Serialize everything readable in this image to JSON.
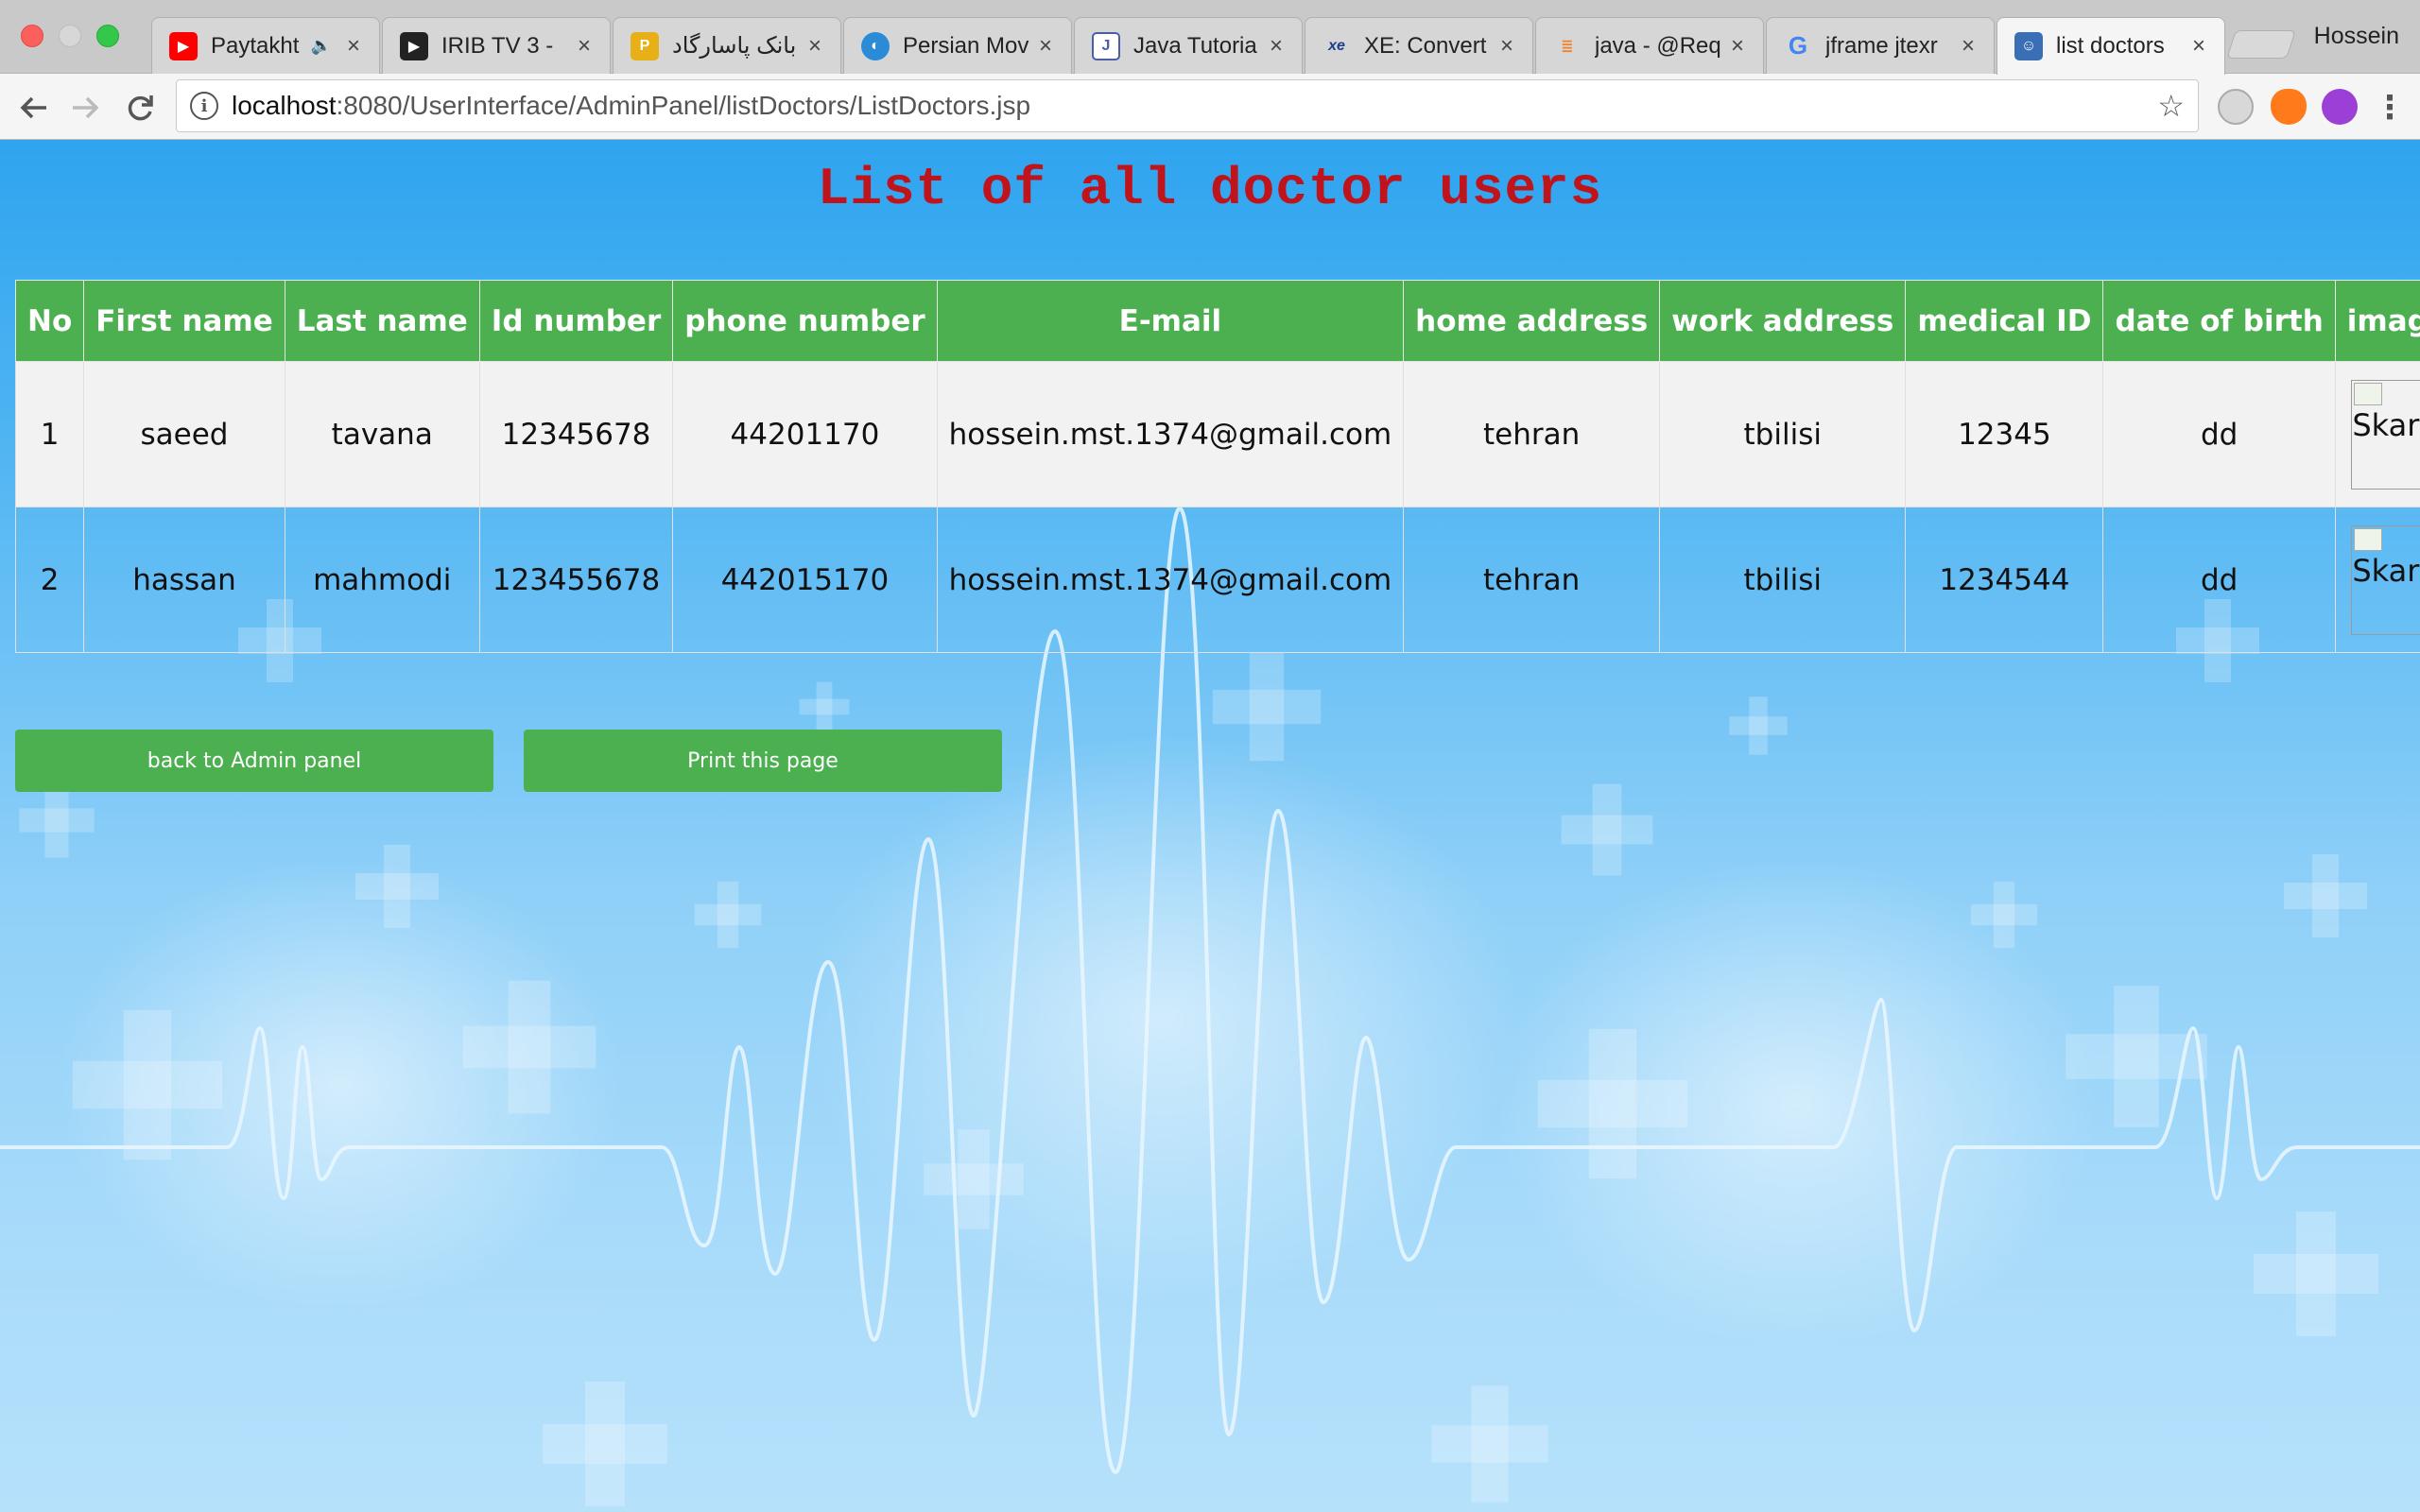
{
  "browser": {
    "tabs": [
      {
        "title": "Paytakht",
        "favicon": "youtube-icon",
        "color": "#ff0000",
        "speaker": true
      },
      {
        "title": "IRIB TV 3 - ",
        "favicon": "play-icon",
        "color": "#222222"
      },
      {
        "title": "بانک پاسارگاد ::",
        "favicon": "pasargad-bank-icon",
        "color": "#e8b017"
      },
      {
        "title": "Persian Mov",
        "favicon": "planet-icon",
        "color": "#2b8bd6"
      },
      {
        "title": "Java Tutoria",
        "favicon": "java-tutorial-icon",
        "color": "#4a5fa8"
      },
      {
        "title": "XE: Convert",
        "favicon": "xe-icon",
        "color": "#1d3f8e"
      },
      {
        "title": "java - @Req",
        "favicon": "stackoverflow-icon",
        "color": "#f48024"
      },
      {
        "title": "jframe jtexr",
        "favicon": "google-icon",
        "color": "#4285f4"
      },
      {
        "title": "list doctors",
        "favicon": "doctor-icon",
        "color": "#3a6fb5",
        "active": true
      }
    ],
    "profile_name": "Hossein",
    "url_host": "localhost",
    "url_rest": ":8080/UserInterface/AdminPanel/listDoctors/ListDoctors.jsp"
  },
  "page": {
    "title": "List of all doctor users",
    "title_color": "#c0141c",
    "accent": "#4caf50"
  },
  "table": {
    "headers": [
      "No",
      "First name",
      "Last name",
      "Id number",
      "phone number",
      "E-mail",
      "home address",
      "work address",
      "medical ID",
      "date of birth",
      "image"
    ],
    "rows": [
      {
        "no": "1",
        "first": "saeed",
        "last": "tavana",
        "id": "12345678",
        "phone": "44201170",
        "email": "hossein.mst.1374@gmail.com",
        "home": "tehran",
        "work": "tbilisi",
        "medical": "12345",
        "dob": "dd",
        "image_alt": "Skaret View"
      },
      {
        "no": "2",
        "first": "hassan",
        "last": "mahmodi",
        "id": "123455678",
        "phone": "442015170",
        "email": "hossein.mst.1374@gmail.com",
        "home": "tehran",
        "work": "tbilisi",
        "medical": "1234544",
        "dob": "dd",
        "image_alt": "Skaret View"
      }
    ]
  },
  "buttons": {
    "back": "back to Admin panel",
    "print": "Print this page"
  }
}
